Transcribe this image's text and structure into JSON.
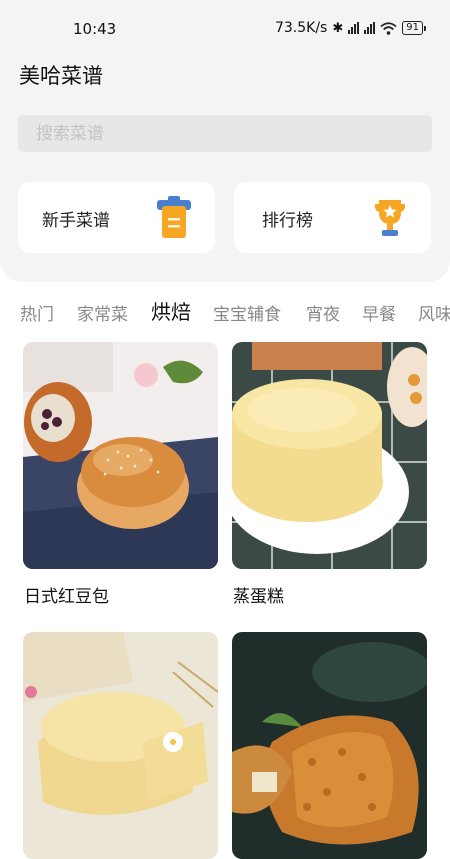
{
  "status_bar": {
    "time": "10:43",
    "net_speed": "73.5K/s",
    "battery": "91"
  },
  "app_title": "美哈菜谱",
  "search": {
    "placeholder": "搜索菜谱"
  },
  "quick_cards": [
    {
      "label": "新手菜谱",
      "icon": "clipboard-icon",
      "color": "#f6a623"
    },
    {
      "label": "排行榜",
      "icon": "trophy-icon",
      "color": "#f6a623"
    }
  ],
  "category_tabs": [
    "热门",
    "家常菜",
    "烘焙",
    "宝宝辅食",
    "宵夜",
    "早餐",
    "风味"
  ],
  "active_tab": "烘焙",
  "recipes": [
    {
      "name": "日式红豆包"
    },
    {
      "name": "蒸蛋糕"
    },
    {
      "name": ""
    },
    {
      "name": ""
    }
  ]
}
